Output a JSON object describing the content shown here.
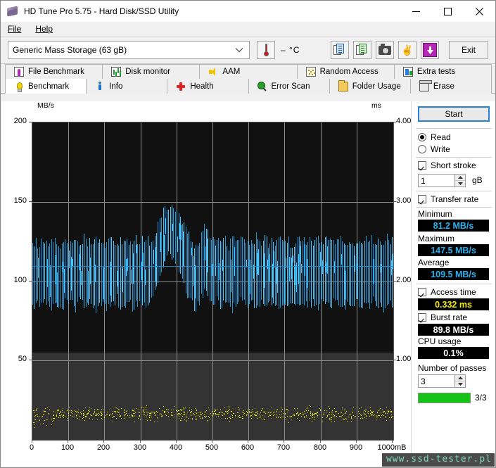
{
  "window": {
    "title": "HD Tune Pro 5.75 - Hard Disk/SSD Utility",
    "app_icon": "hdtune-disc-icon",
    "minimize": "─",
    "maximize": "□",
    "close": "✕"
  },
  "menu": {
    "items": [
      {
        "label": "File",
        "mnemonic": "F"
      },
      {
        "label": "Help",
        "mnemonic": "H"
      }
    ]
  },
  "toolbar": {
    "drive_value": "Generic Mass Storage (63 gB)",
    "drive_placeholder": "Select drive",
    "dropdown_icon": "chevron-down-icon",
    "temperature": "–  °C",
    "thermometer_icon": "thermometer-icon",
    "buttons": [
      {
        "name": "copy-to-clipboard-button",
        "icon": "copy-document-icon"
      },
      {
        "name": "save-report-button",
        "icon": "copy-document-green-icon"
      },
      {
        "name": "screenshot-button",
        "icon": "camera-icon"
      },
      {
        "name": "helping-hand-button",
        "icon": "hand-icon"
      },
      {
        "name": "download-update-button",
        "icon": "download-arrow-icon"
      }
    ],
    "exit_label": "Exit"
  },
  "tabs": {
    "top_row": [
      {
        "label": "File Benchmark",
        "icon": "file-benchmark-icon",
        "active": false
      },
      {
        "label": "Disk monitor",
        "icon": "disk-monitor-icon",
        "active": false
      },
      {
        "label": "AAM",
        "icon": "speaker-icon",
        "active": false
      },
      {
        "label": "Random Access",
        "icon": "random-access-icon",
        "active": false
      },
      {
        "label": "Extra tests",
        "icon": "extra-tests-icon",
        "active": false
      }
    ],
    "bottom_row": [
      {
        "label": "Benchmark",
        "icon": "lightbulb-icon",
        "active": true
      },
      {
        "label": "Info",
        "icon": "info-icon",
        "active": false
      },
      {
        "label": "Health",
        "icon": "health-cross-icon",
        "active": false
      },
      {
        "label": "Error Scan",
        "icon": "magnifier-icon",
        "active": false
      },
      {
        "label": "Folder Usage",
        "icon": "folder-icon",
        "active": false
      },
      {
        "label": "Erase",
        "icon": "trash-icon",
        "active": false
      }
    ]
  },
  "side_panel": {
    "start_label": "Start",
    "mode": {
      "read_label": "Read",
      "write_label": "Write",
      "selected": "Read"
    },
    "short_stroke": {
      "label": "Short stroke",
      "checked": true,
      "value": "1",
      "unit": "gB",
      "spinner_up_icon": "spinner-up-icon",
      "spinner_down_icon": "spinner-down-icon"
    },
    "transfer_rate": {
      "label": "Transfer rate",
      "checked": true,
      "minimum_label": "Minimum",
      "minimum_value": "81.2 MB/s",
      "maximum_label": "Maximum",
      "maximum_value": "147.5 MB/s",
      "average_label": "Average",
      "average_value": "109.5 MB/s"
    },
    "access_time": {
      "label": "Access time",
      "checked": true,
      "value": "0.332 ms"
    },
    "burst_rate": {
      "label": "Burst rate",
      "checked": true,
      "value": "89.8 MB/s"
    },
    "cpu_usage": {
      "label": "CPU usage",
      "value": "0.1%"
    },
    "passes": {
      "label": "Number of passes",
      "value": "3",
      "progress_label": "3/3",
      "progress_percent": 100,
      "progress_color": "#19c219"
    }
  },
  "watermark": {
    "text": "www.ssd-tester.pl"
  },
  "chart_data": {
    "type": "line",
    "title": "",
    "xlabel": "mB",
    "ylabel": "MB/s",
    "y2label": "ms",
    "grid": true,
    "legend": null,
    "x": [
      0,
      100,
      200,
      300,
      400,
      500,
      600,
      700,
      800,
      900,
      1000
    ],
    "xticklabels": [
      "0",
      "100",
      "200",
      "300",
      "400",
      "500",
      "600",
      "700",
      "800",
      "900",
      "1000mB"
    ],
    "xlim": [
      0,
      1000
    ],
    "ylim": [
      0,
      200
    ],
    "yticks": [
      50,
      100,
      150,
      200
    ],
    "yticklabels": [
      "50",
      "100",
      "150",
      "200"
    ],
    "y2lim": [
      0,
      4.0
    ],
    "y2ticks": [
      1.0,
      2.0,
      3.0,
      4.0
    ],
    "y2ticklabels": [
      "1.00",
      "2.00",
      "3.00",
      "4.00"
    ],
    "series": [
      {
        "name": "Transfer rate",
        "color": "#2196d6",
        "axis": "left",
        "unit": "MB/s",
        "minimum": 81.2,
        "maximum": 147.5,
        "average": 109.5,
        "envelope_top": [
          124,
          126,
          122,
          127,
          125,
          123,
          128,
          124,
          126,
          122,
          125,
          127,
          124,
          123,
          126,
          125,
          122,
          128,
          124,
          126,
          123,
          127,
          125,
          124,
          122,
          126,
          128,
          125,
          123,
          127,
          124,
          126,
          122,
          125,
          128,
          123,
          127,
          124,
          126,
          125,
          129,
          133,
          138,
          143,
          146,
          147,
          145,
          147,
          144,
          141,
          137,
          132,
          128,
          125,
          122,
          126,
          130,
          134,
          131,
          127,
          125,
          123,
          127,
          124,
          126,
          122,
          128,
          125,
          123,
          126,
          124,
          127,
          125,
          122,
          128,
          126,
          123,
          127,
          124,
          125,
          126,
          123,
          128,
          124,
          127,
          125,
          122,
          126,
          129,
          124,
          127,
          123,
          126,
          125,
          128,
          124,
          122,
          127,
          125,
          123,
          126,
          124,
          128,
          125,
          122,
          127,
          124,
          126,
          123,
          125,
          128,
          124,
          127,
          122,
          126,
          125,
          123,
          128,
          124,
          127
        ],
        "envelope_bottom": [
          86,
          84,
          88,
          83,
          87,
          85,
          82,
          89,
          84,
          86,
          83,
          88,
          85,
          87,
          82,
          86,
          89,
          84,
          83,
          87,
          85,
          82,
          88,
          86,
          84,
          83,
          87,
          85,
          89,
          82,
          86,
          84,
          88,
          83,
          85,
          87,
          82,
          86,
          84,
          88,
          92,
          98,
          104,
          110,
          115,
          117,
          116,
          114,
          110,
          105,
          99,
          93,
          88,
          85,
          83,
          87,
          90,
          94,
          91,
          86,
          84,
          88,
          83,
          86,
          85,
          89,
          82,
          87,
          84,
          88,
          86,
          83,
          85,
          89,
          82,
          84,
          87,
          83,
          86,
          88,
          84,
          87,
          82,
          86,
          83,
          85,
          88,
          84,
          82,
          87,
          83,
          86,
          84,
          88,
          82,
          85,
          87,
          83,
          86,
          84,
          88,
          85,
          82,
          87,
          84,
          83,
          86,
          88,
          85,
          82,
          87,
          84,
          86,
          88,
          83,
          85,
          82,
          84,
          87,
          86
        ]
      },
      {
        "name": "Access time",
        "color": "#f2f20a",
        "axis": "right",
        "unit": "ms",
        "value": 0.332,
        "scatter_center_ms": 0.33,
        "scatter_spread_ms": 0.12,
        "point_count": 900
      }
    ]
  }
}
